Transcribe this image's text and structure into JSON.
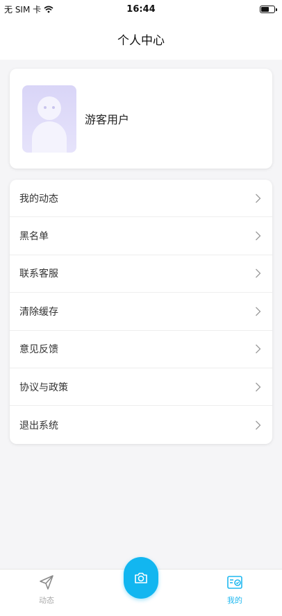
{
  "status_bar": {
    "carrier": "无 SIM 卡",
    "time": "16:44",
    "icons": [
      "wifi-icon",
      "battery-icon"
    ]
  },
  "nav": {
    "title": "个人中心"
  },
  "profile": {
    "name": "游客用户",
    "avatar_icon": "avatar-placeholder"
  },
  "menu": {
    "items": [
      {
        "label": "我的动态"
      },
      {
        "label": "黑名单"
      },
      {
        "label": "联系客服"
      },
      {
        "label": "清除缓存"
      },
      {
        "label": "意见反馈"
      },
      {
        "label": "协议与政策"
      },
      {
        "label": "退出系统"
      }
    ],
    "chevron_icon": "chevron-right-icon"
  },
  "tabbar": {
    "items": [
      {
        "label": "动态",
        "icon": "send-icon",
        "active": false
      },
      {
        "label": "",
        "icon": "camera-icon",
        "active": false
      },
      {
        "label": "我的",
        "icon": "profile-card-icon",
        "active": true
      }
    ]
  },
  "colors": {
    "accent": "#12b6f0",
    "active_tab": "#1fb8f0",
    "inactive_tab": "#aaaaaa",
    "background": "#f5f5f7"
  }
}
